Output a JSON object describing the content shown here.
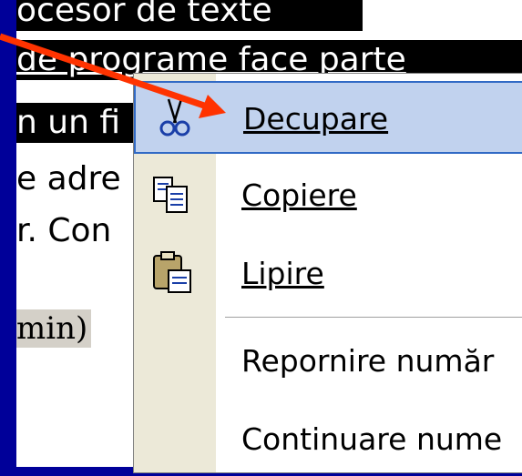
{
  "document": {
    "lines": [
      "ocesor de texte",
      "de programe face parte",
      "n un fi",
      "e adre",
      "r. Con",
      "min)"
    ]
  },
  "context_menu": {
    "items": [
      {
        "label": "Decupare",
        "icon": "scissors-icon"
      },
      {
        "label": "Copiere",
        "icon": "copy-icon"
      },
      {
        "label": "Lipire",
        "icon": "paste-icon"
      },
      {
        "label": "Repornire număr"
      },
      {
        "label": "Continuare nume"
      }
    ]
  },
  "colors": {
    "border_blue": "#000099",
    "hover_bg": "#c1d2ee",
    "hover_border": "#316ac5",
    "arrow": "#ff3300"
  }
}
